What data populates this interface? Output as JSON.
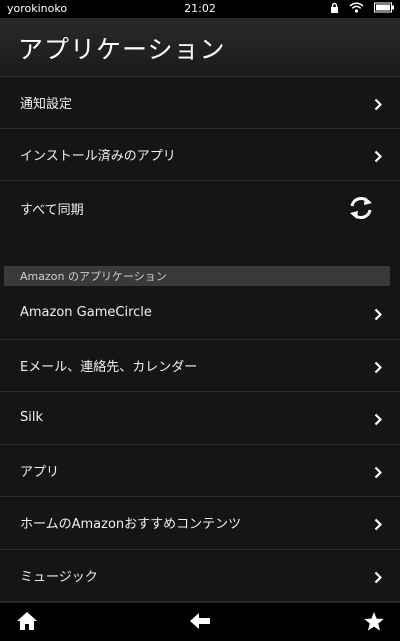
{
  "status_bar": {
    "carrier": "yorokinoko",
    "time": "21:02",
    "icons": [
      "lock-icon",
      "wifi-icon",
      "battery-icon"
    ]
  },
  "header": {
    "title": "アプリケーション"
  },
  "settings_items": [
    {
      "label": "通知設定",
      "icon": "chevron-right-icon"
    },
    {
      "label": "インストール済みのアプリ",
      "icon": "chevron-right-icon"
    },
    {
      "label": "すべて同期",
      "icon": "sync-icon"
    }
  ],
  "section": {
    "title": "Amazon のアプリケーション"
  },
  "amazon_apps": [
    {
      "label": "Amazon GameCircle"
    },
    {
      "label": "Eメール、連絡先、カレンダー"
    },
    {
      "label": "Silk"
    },
    {
      "label": "アプリ"
    },
    {
      "label": "ホームのAmazonおすすめコンテンツ"
    },
    {
      "label": "ミュージック"
    }
  ],
  "bottom_nav": [
    "home-icon",
    "back-arrow-icon",
    "star-icon"
  ],
  "colors": {
    "background": "#151515",
    "header": "#2a2a2a",
    "section_header": "#3a3a3a",
    "text": "#f2f2f2"
  }
}
